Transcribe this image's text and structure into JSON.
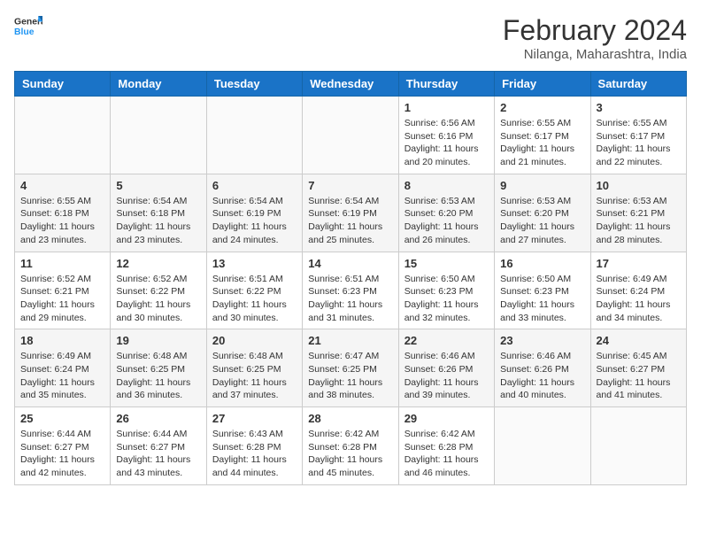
{
  "header": {
    "logo_general": "General",
    "logo_blue": "Blue",
    "month_year": "February 2024",
    "location": "Nilanga, Maharashtra, India"
  },
  "days_of_week": [
    "Sunday",
    "Monday",
    "Tuesday",
    "Wednesday",
    "Thursday",
    "Friday",
    "Saturday"
  ],
  "weeks": [
    {
      "row_class": "row-odd",
      "days": [
        {
          "number": "",
          "empty": true,
          "info": ""
        },
        {
          "number": "",
          "empty": true,
          "info": ""
        },
        {
          "number": "",
          "empty": true,
          "info": ""
        },
        {
          "number": "",
          "empty": true,
          "info": ""
        },
        {
          "number": "1",
          "empty": false,
          "info": "Sunrise: 6:56 AM\nSunset: 6:16 PM\nDaylight: 11 hours and 20 minutes."
        },
        {
          "number": "2",
          "empty": false,
          "info": "Sunrise: 6:55 AM\nSunset: 6:17 PM\nDaylight: 11 hours and 21 minutes."
        },
        {
          "number": "3",
          "empty": false,
          "info": "Sunrise: 6:55 AM\nSunset: 6:17 PM\nDaylight: 11 hours and 22 minutes."
        }
      ]
    },
    {
      "row_class": "row-even",
      "days": [
        {
          "number": "4",
          "empty": false,
          "info": "Sunrise: 6:55 AM\nSunset: 6:18 PM\nDaylight: 11 hours and 23 minutes."
        },
        {
          "number": "5",
          "empty": false,
          "info": "Sunrise: 6:54 AM\nSunset: 6:18 PM\nDaylight: 11 hours and 23 minutes."
        },
        {
          "number": "6",
          "empty": false,
          "info": "Sunrise: 6:54 AM\nSunset: 6:19 PM\nDaylight: 11 hours and 24 minutes."
        },
        {
          "number": "7",
          "empty": false,
          "info": "Sunrise: 6:54 AM\nSunset: 6:19 PM\nDaylight: 11 hours and 25 minutes."
        },
        {
          "number": "8",
          "empty": false,
          "info": "Sunrise: 6:53 AM\nSunset: 6:20 PM\nDaylight: 11 hours and 26 minutes."
        },
        {
          "number": "9",
          "empty": false,
          "info": "Sunrise: 6:53 AM\nSunset: 6:20 PM\nDaylight: 11 hours and 27 minutes."
        },
        {
          "number": "10",
          "empty": false,
          "info": "Sunrise: 6:53 AM\nSunset: 6:21 PM\nDaylight: 11 hours and 28 minutes."
        }
      ]
    },
    {
      "row_class": "row-odd",
      "days": [
        {
          "number": "11",
          "empty": false,
          "info": "Sunrise: 6:52 AM\nSunset: 6:21 PM\nDaylight: 11 hours and 29 minutes."
        },
        {
          "number": "12",
          "empty": false,
          "info": "Sunrise: 6:52 AM\nSunset: 6:22 PM\nDaylight: 11 hours and 30 minutes."
        },
        {
          "number": "13",
          "empty": false,
          "info": "Sunrise: 6:51 AM\nSunset: 6:22 PM\nDaylight: 11 hours and 30 minutes."
        },
        {
          "number": "14",
          "empty": false,
          "info": "Sunrise: 6:51 AM\nSunset: 6:23 PM\nDaylight: 11 hours and 31 minutes."
        },
        {
          "number": "15",
          "empty": false,
          "info": "Sunrise: 6:50 AM\nSunset: 6:23 PM\nDaylight: 11 hours and 32 minutes."
        },
        {
          "number": "16",
          "empty": false,
          "info": "Sunrise: 6:50 AM\nSunset: 6:23 PM\nDaylight: 11 hours and 33 minutes."
        },
        {
          "number": "17",
          "empty": false,
          "info": "Sunrise: 6:49 AM\nSunset: 6:24 PM\nDaylight: 11 hours and 34 minutes."
        }
      ]
    },
    {
      "row_class": "row-even",
      "days": [
        {
          "number": "18",
          "empty": false,
          "info": "Sunrise: 6:49 AM\nSunset: 6:24 PM\nDaylight: 11 hours and 35 minutes."
        },
        {
          "number": "19",
          "empty": false,
          "info": "Sunrise: 6:48 AM\nSunset: 6:25 PM\nDaylight: 11 hours and 36 minutes."
        },
        {
          "number": "20",
          "empty": false,
          "info": "Sunrise: 6:48 AM\nSunset: 6:25 PM\nDaylight: 11 hours and 37 minutes."
        },
        {
          "number": "21",
          "empty": false,
          "info": "Sunrise: 6:47 AM\nSunset: 6:25 PM\nDaylight: 11 hours and 38 minutes."
        },
        {
          "number": "22",
          "empty": false,
          "info": "Sunrise: 6:46 AM\nSunset: 6:26 PM\nDaylight: 11 hours and 39 minutes."
        },
        {
          "number": "23",
          "empty": false,
          "info": "Sunrise: 6:46 AM\nSunset: 6:26 PM\nDaylight: 11 hours and 40 minutes."
        },
        {
          "number": "24",
          "empty": false,
          "info": "Sunrise: 6:45 AM\nSunset: 6:27 PM\nDaylight: 11 hours and 41 minutes."
        }
      ]
    },
    {
      "row_class": "row-odd",
      "days": [
        {
          "number": "25",
          "empty": false,
          "info": "Sunrise: 6:44 AM\nSunset: 6:27 PM\nDaylight: 11 hours and 42 minutes."
        },
        {
          "number": "26",
          "empty": false,
          "info": "Sunrise: 6:44 AM\nSunset: 6:27 PM\nDaylight: 11 hours and 43 minutes."
        },
        {
          "number": "27",
          "empty": false,
          "info": "Sunrise: 6:43 AM\nSunset: 6:28 PM\nDaylight: 11 hours and 44 minutes."
        },
        {
          "number": "28",
          "empty": false,
          "info": "Sunrise: 6:42 AM\nSunset: 6:28 PM\nDaylight: 11 hours and 45 minutes."
        },
        {
          "number": "29",
          "empty": false,
          "info": "Sunrise: 6:42 AM\nSunset: 6:28 PM\nDaylight: 11 hours and 46 minutes."
        },
        {
          "number": "",
          "empty": true,
          "info": ""
        },
        {
          "number": "",
          "empty": true,
          "info": ""
        }
      ]
    }
  ]
}
